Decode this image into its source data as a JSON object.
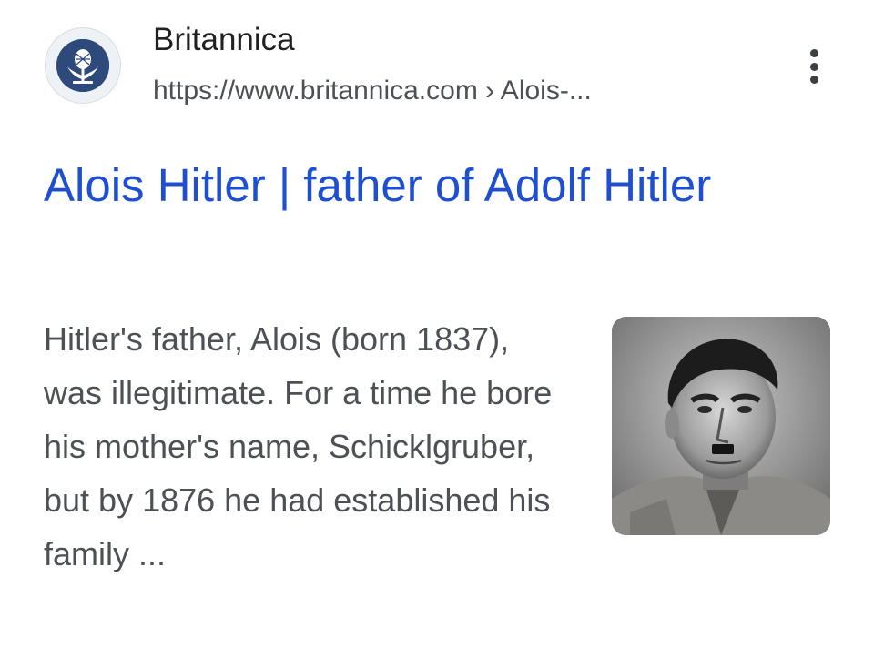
{
  "result": {
    "site_name": "Britannica",
    "url": "https://www.britannica.com › Alois-...",
    "title": "Alois Hitler | father of Adolf Hitler",
    "snippet": "Hitler's father, Alois (born 1837), was illegitimate. For a time he bore his mother's name, Schicklgruber, but by 1876 he had established his family ...",
    "favicon_icon": "britannica-thistle-icon",
    "menu_icon": "more-vert-icon",
    "thumbnail": "portrait-photo-thumbnail"
  },
  "colors": {
    "title_link": "#1f4fd1",
    "site_name": "#202124",
    "url": "#4d5156",
    "snippet": "#4d5156",
    "favicon_bg": "#2d4a7a"
  }
}
